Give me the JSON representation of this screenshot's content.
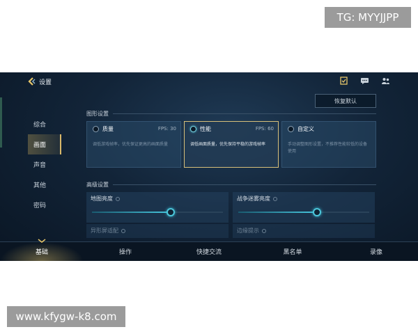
{
  "overlays": {
    "tg_label": "TG: MYYJJPP",
    "watermark": "www.kfygw-k8.com"
  },
  "header": {
    "title": "设置",
    "reset_label": "恢复默认",
    "icons": [
      "task-icon",
      "chat-icon",
      "friends-icon"
    ]
  },
  "sidebar": {
    "items": [
      {
        "label": "综合"
      },
      {
        "label": "画面"
      },
      {
        "label": "声音"
      },
      {
        "label": "其他"
      },
      {
        "label": "密码"
      }
    ],
    "active_index": 1
  },
  "graphics": {
    "section_title": "图形设置",
    "options": [
      {
        "title": "质量",
        "fps": "FPS: 30",
        "desc": "调低游戏帧率，优先保证更高的画面质量"
      },
      {
        "title": "性能",
        "fps": "FPS: 60",
        "desc": "调低画面质量，优先保持平稳的游戏帧率"
      },
      {
        "title": "自定义",
        "fps": "",
        "desc": "手动调整图形设置，不推荐性能较低的设备使用"
      }
    ],
    "selected_index": 1
  },
  "advanced": {
    "section_title": "高级设置",
    "sliders": [
      {
        "label": "地图亮度",
        "value": 0.6
      },
      {
        "label": "战争迷雾亮度",
        "value": 0.6
      }
    ],
    "partial_items": [
      {
        "label": "异形屏适配"
      },
      {
        "label": "边缘提示"
      }
    ]
  },
  "bottom_tabs": {
    "items": [
      {
        "label": "基础"
      },
      {
        "label": "操作"
      },
      {
        "label": "快捷交流"
      },
      {
        "label": "黑名单"
      },
      {
        "label": "录像"
      }
    ],
    "active_index": 0
  },
  "colors": {
    "accent_gold": "#d8c07a",
    "accent_cyan": "#4cc6da",
    "background": "#122438"
  }
}
